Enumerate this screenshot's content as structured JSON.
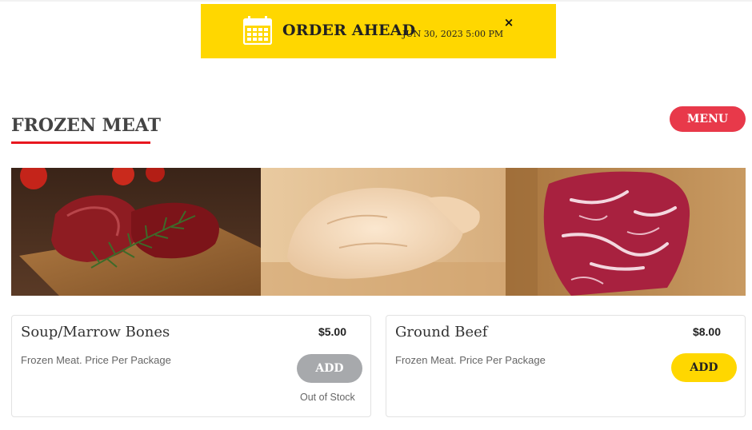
{
  "banner": {
    "title": "ORDER AHEAD",
    "date": "JUN 30, 2023 5:00 PM",
    "close": "×",
    "icon": "calendar-icon",
    "color": "#ffd700"
  },
  "section": {
    "title": "FROZEN MEAT",
    "underline_color": "#e8171f",
    "menu_label": "MENU",
    "menu_color": "#e8394a"
  },
  "hero": {
    "panels": [
      "beef-cuts-on-board-image",
      "raw-whole-chicken-image",
      "marbled-steak-image"
    ]
  },
  "products": [
    {
      "name": "Soup/Marrow Bones",
      "price": "$5.00",
      "description": "Frozen Meat. Price Per Package",
      "add_label": "ADD",
      "status": "Out of Stock",
      "button_color": "#a7a9ac"
    },
    {
      "name": "Ground Beef",
      "price": "$8.00",
      "description": "Frozen Meat. Price Per Package",
      "add_label": "ADD",
      "button_color": "#ffd700"
    }
  ]
}
